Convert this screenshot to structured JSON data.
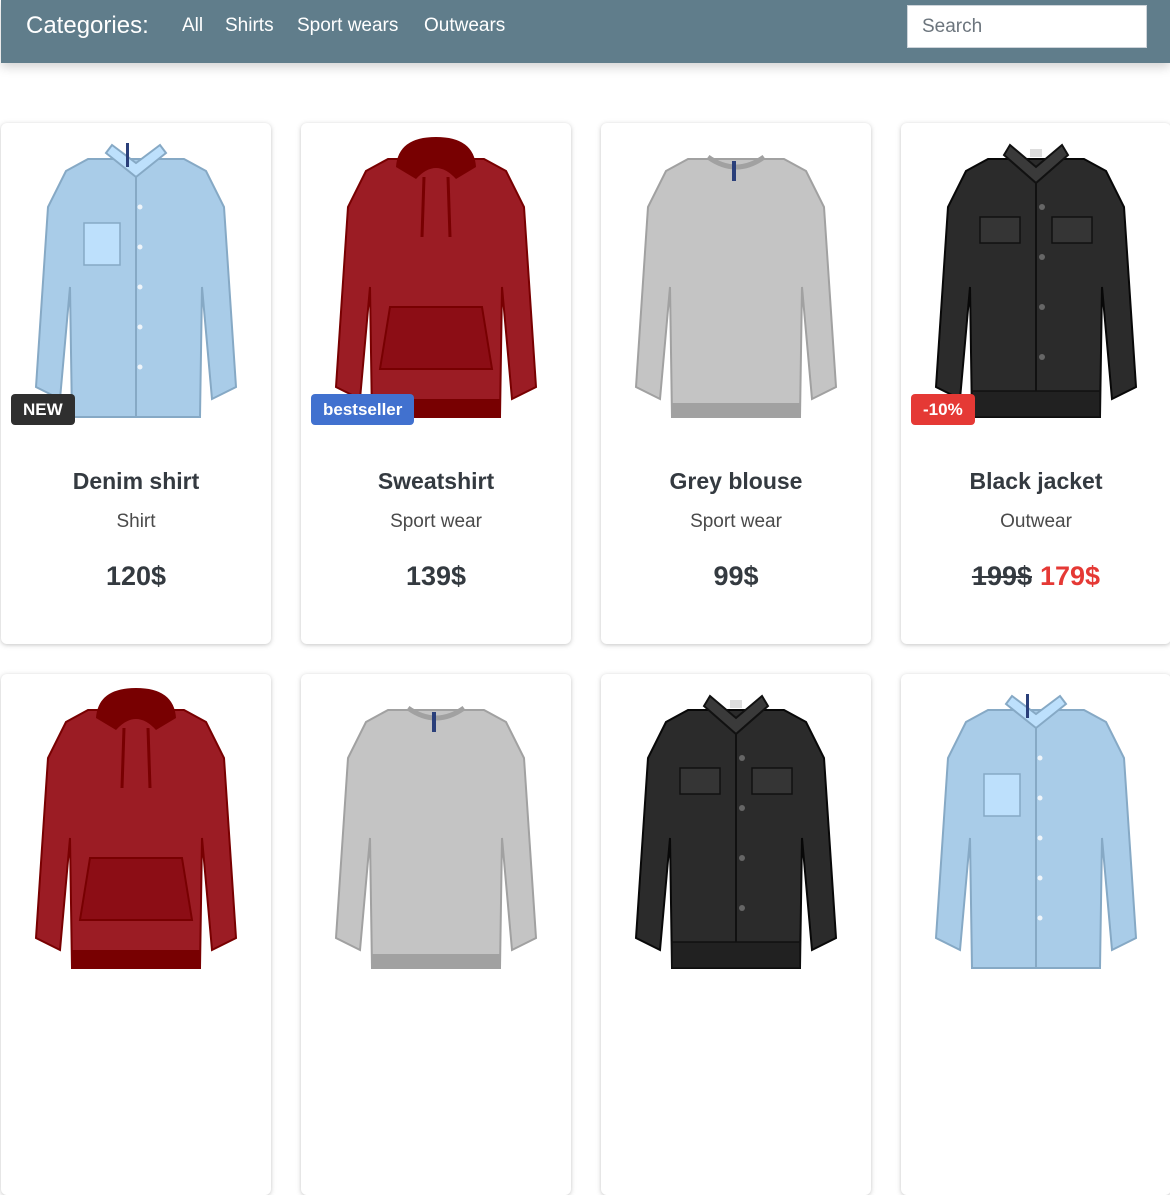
{
  "header": {
    "title": "Categories:",
    "nav": [
      "All",
      "Shirts",
      "Sport wears",
      "Outwears"
    ],
    "search_placeholder": "Search"
  },
  "products": [
    {
      "name": "Denim shirt",
      "category": "Shirt",
      "price": "120$",
      "badge": "NEW",
      "garment": "shirt",
      "color": "#a9cce8"
    },
    {
      "name": "Sweatshirt",
      "category": "Sport wear",
      "price": "139$",
      "badge": "bestseller",
      "garment": "hoodie",
      "color": "#9b1c24"
    },
    {
      "name": "Grey blouse",
      "category": "Sport wear",
      "price": "99$",
      "badge": "",
      "garment": "sweater",
      "color": "#c4c4c4"
    },
    {
      "name": "Black jacket",
      "category": "Outwear",
      "old_price": "199$",
      "price": "179$",
      "badge": "-10%",
      "garment": "jacket",
      "color": "#2b2b2b"
    }
  ],
  "second_row": [
    {
      "garment": "hoodie",
      "color": "#9b1c24"
    },
    {
      "garment": "sweater",
      "color": "#c4c4c4"
    },
    {
      "garment": "jacket",
      "color": "#2b2b2b"
    },
    {
      "garment": "shirt",
      "color": "#a9cce8"
    }
  ],
  "colors": {
    "navbar": "#607d8b",
    "badge_new": "#2f2f2f",
    "badge_bestseller": "#4171cf",
    "badge_discount": "#e53935",
    "sale_price": "#e53935"
  }
}
